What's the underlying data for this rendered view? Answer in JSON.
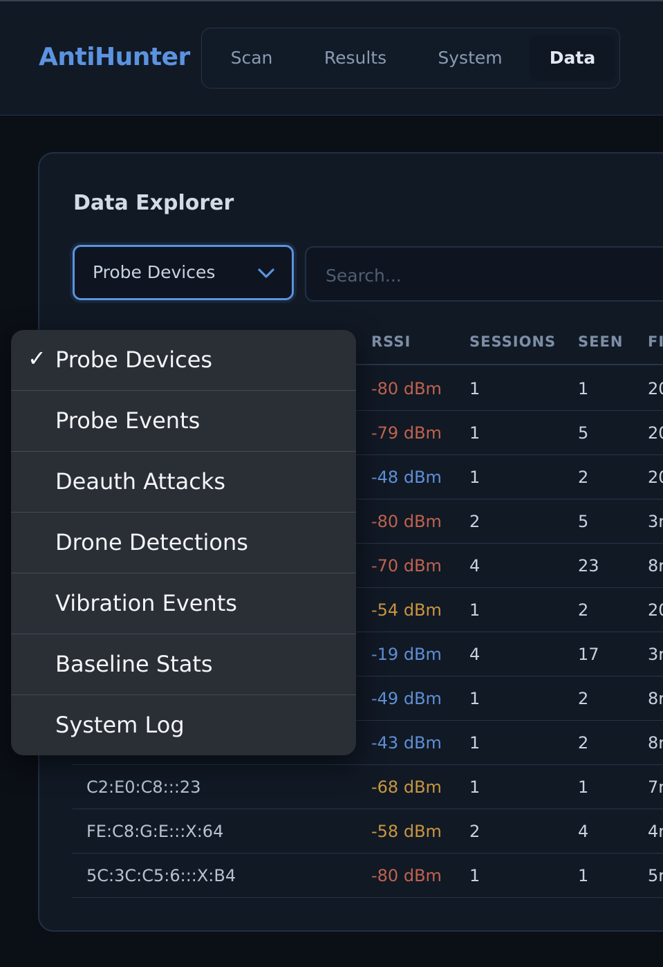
{
  "app": {
    "title": "AntiHunter"
  },
  "nav": {
    "tabs": [
      {
        "label": "Scan"
      },
      {
        "label": "Results"
      },
      {
        "label": "System"
      },
      {
        "label": "Data"
      }
    ],
    "active": "Data"
  },
  "panel": {
    "title": "Data Explorer",
    "select_value": "Probe Devices",
    "search_placeholder": "Search..."
  },
  "dropdown": {
    "options": [
      {
        "label": "Probe Devices",
        "check": "✓"
      },
      {
        "label": "Probe Events",
        "check": ""
      },
      {
        "label": "Deauth Attacks",
        "check": ""
      },
      {
        "label": "Drone Detections",
        "check": ""
      },
      {
        "label": "Vibration Events",
        "check": ""
      },
      {
        "label": "Baseline Stats",
        "check": ""
      },
      {
        "label": "System Log",
        "check": ""
      }
    ]
  },
  "table": {
    "headers": [
      "RSSI",
      "SESSIONS",
      "SEEN",
      "FI"
    ],
    "rows": [
      {
        "mac": "",
        "rssi": "-80 dBm",
        "sessions": "1",
        "seen": "1",
        "first": "20",
        "tone": "red"
      },
      {
        "mac": "",
        "rssi": "-79 dBm",
        "sessions": "1",
        "seen": "5",
        "first": "20",
        "tone": "red"
      },
      {
        "mac": "",
        "rssi": "-48 dBm",
        "sessions": "1",
        "seen": "2",
        "first": "20",
        "tone": "blue"
      },
      {
        "mac": "",
        "rssi": "-80 dBm",
        "sessions": "2",
        "seen": "5",
        "first": "3r",
        "tone": "red"
      },
      {
        "mac": "",
        "rssi": "-70 dBm",
        "sessions": "4",
        "seen": "23",
        "first": "8r",
        "tone": "red"
      },
      {
        "mac": "",
        "rssi": "-54 dBm",
        "sessions": "1",
        "seen": "2",
        "first": "20",
        "tone": "amber"
      },
      {
        "mac": "",
        "rssi": "-19 dBm",
        "sessions": "4",
        "seen": "17",
        "first": "3r",
        "tone": "blue"
      },
      {
        "mac": "",
        "rssi": "-49 dBm",
        "sessions": "1",
        "seen": "2",
        "first": "8r",
        "tone": "blue"
      },
      {
        "mac": "",
        "rssi": "-43 dBm",
        "sessions": "1",
        "seen": "2",
        "first": "8r",
        "tone": "blue"
      },
      {
        "mac": "C2:E0:C8:::23",
        "rssi": "-68 dBm",
        "sessions": "1",
        "seen": "1",
        "first": "7r",
        "tone": "amber"
      },
      {
        "mac": "FE:C8:G:E:::X:64",
        "rssi": "-58 dBm",
        "sessions": "2",
        "seen": "4",
        "first": "4r",
        "tone": "amber"
      },
      {
        "mac": "5C:3C:C5:6:::X:B4",
        "rssi": "-80 dBm",
        "sessions": "1",
        "seen": "1",
        "first": "5r",
        "tone": "red"
      }
    ]
  },
  "colors": {
    "accent": "#5b93e0",
    "rssi_red": "#c0624e",
    "rssi_amber": "#c9963f",
    "rssi_blue": "#5f8fd6"
  }
}
